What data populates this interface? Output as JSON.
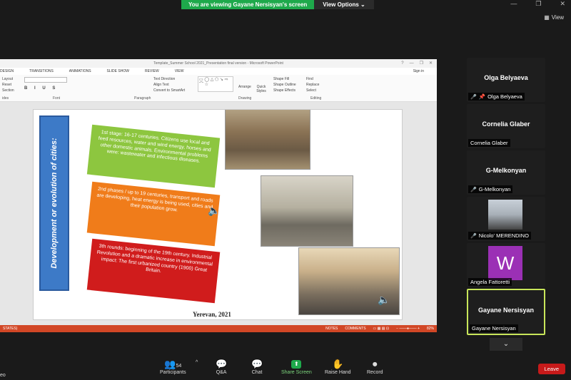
{
  "banner": {
    "status": "You are viewing Gayane Nersisyan's screen",
    "options": "View Options"
  },
  "top_right": {
    "view_label": "View"
  },
  "ppt": {
    "window_title": "Template_Summer School 2021_Presentation final version - Microsoft PowerPoint",
    "tabs": [
      "DESIGN",
      "TRANSITIONS",
      "ANIMATIONS",
      "SLIDE SHOW",
      "REVIEW",
      "VIEW"
    ],
    "sign_in": "Sign in",
    "ribbon": {
      "slide_items": [
        "Layout",
        "Reset",
        "Section"
      ],
      "text_items": [
        "Text Direction",
        "Align Text",
        "Convert to SmartArt"
      ],
      "drawing_items": [
        "Shape Fill",
        "Shape Outline",
        "Shape Effects"
      ],
      "arrange": "Arrange",
      "quick_styles": "Quick Styles",
      "edit_items": [
        "Find",
        "Replace",
        "Select"
      ],
      "groups": [
        "ides",
        "Font",
        "Paragraph",
        "Drawing",
        "Editing"
      ]
    },
    "status": {
      "left": "STATES)",
      "notes": "NOTES",
      "comments": "COMMENTS",
      "zoom": "82%"
    }
  },
  "slide": {
    "vertical_title": "Development or evolution of cities:",
    "stage1": "1st stage: 16-17 centuries. Citizens use local and feed resources, water and wind energy, horses and other domestic animals. Environmental problems were: wastewater and infectious diseases.",
    "stage2": "2nd phases / up to 19 centuries, transport and roads are developing, heat energy is being used, cities and their population grow.",
    "stage3": "3th rounds: beginning of the 19th century. Industrial Revolution and a dramatic increase in environmental impact: The first urbanized country (1900) Great Britain.",
    "footer": "Yerevan, 2021"
  },
  "participants": [
    {
      "big": "Olga Belyaeva",
      "label": "Olga Belyaeva",
      "muted": true
    },
    {
      "big": "Cornelia Glaber",
      "label": "Cornelia Glaber",
      "muted": false
    },
    {
      "big": "G-Melkonyan",
      "label": "G-Melkonyan",
      "muted": true
    },
    {
      "big": "",
      "label": "Nicolo' MERENDINO",
      "muted": true
    },
    {
      "big": "W",
      "label": "Angela Fattoretti",
      "muted": false
    },
    {
      "big": "Gayane Nersisyan",
      "label": "Gayane Nersisyan",
      "muted": false
    }
  ],
  "toolbar": {
    "participants": "Participants",
    "participants_count": "54",
    "qa": "Q&A",
    "chat": "Chat",
    "share": "Share Screen",
    "raise": "Raise Hand",
    "record": "Record",
    "leave": "Leave",
    "video_cut": "eo"
  }
}
